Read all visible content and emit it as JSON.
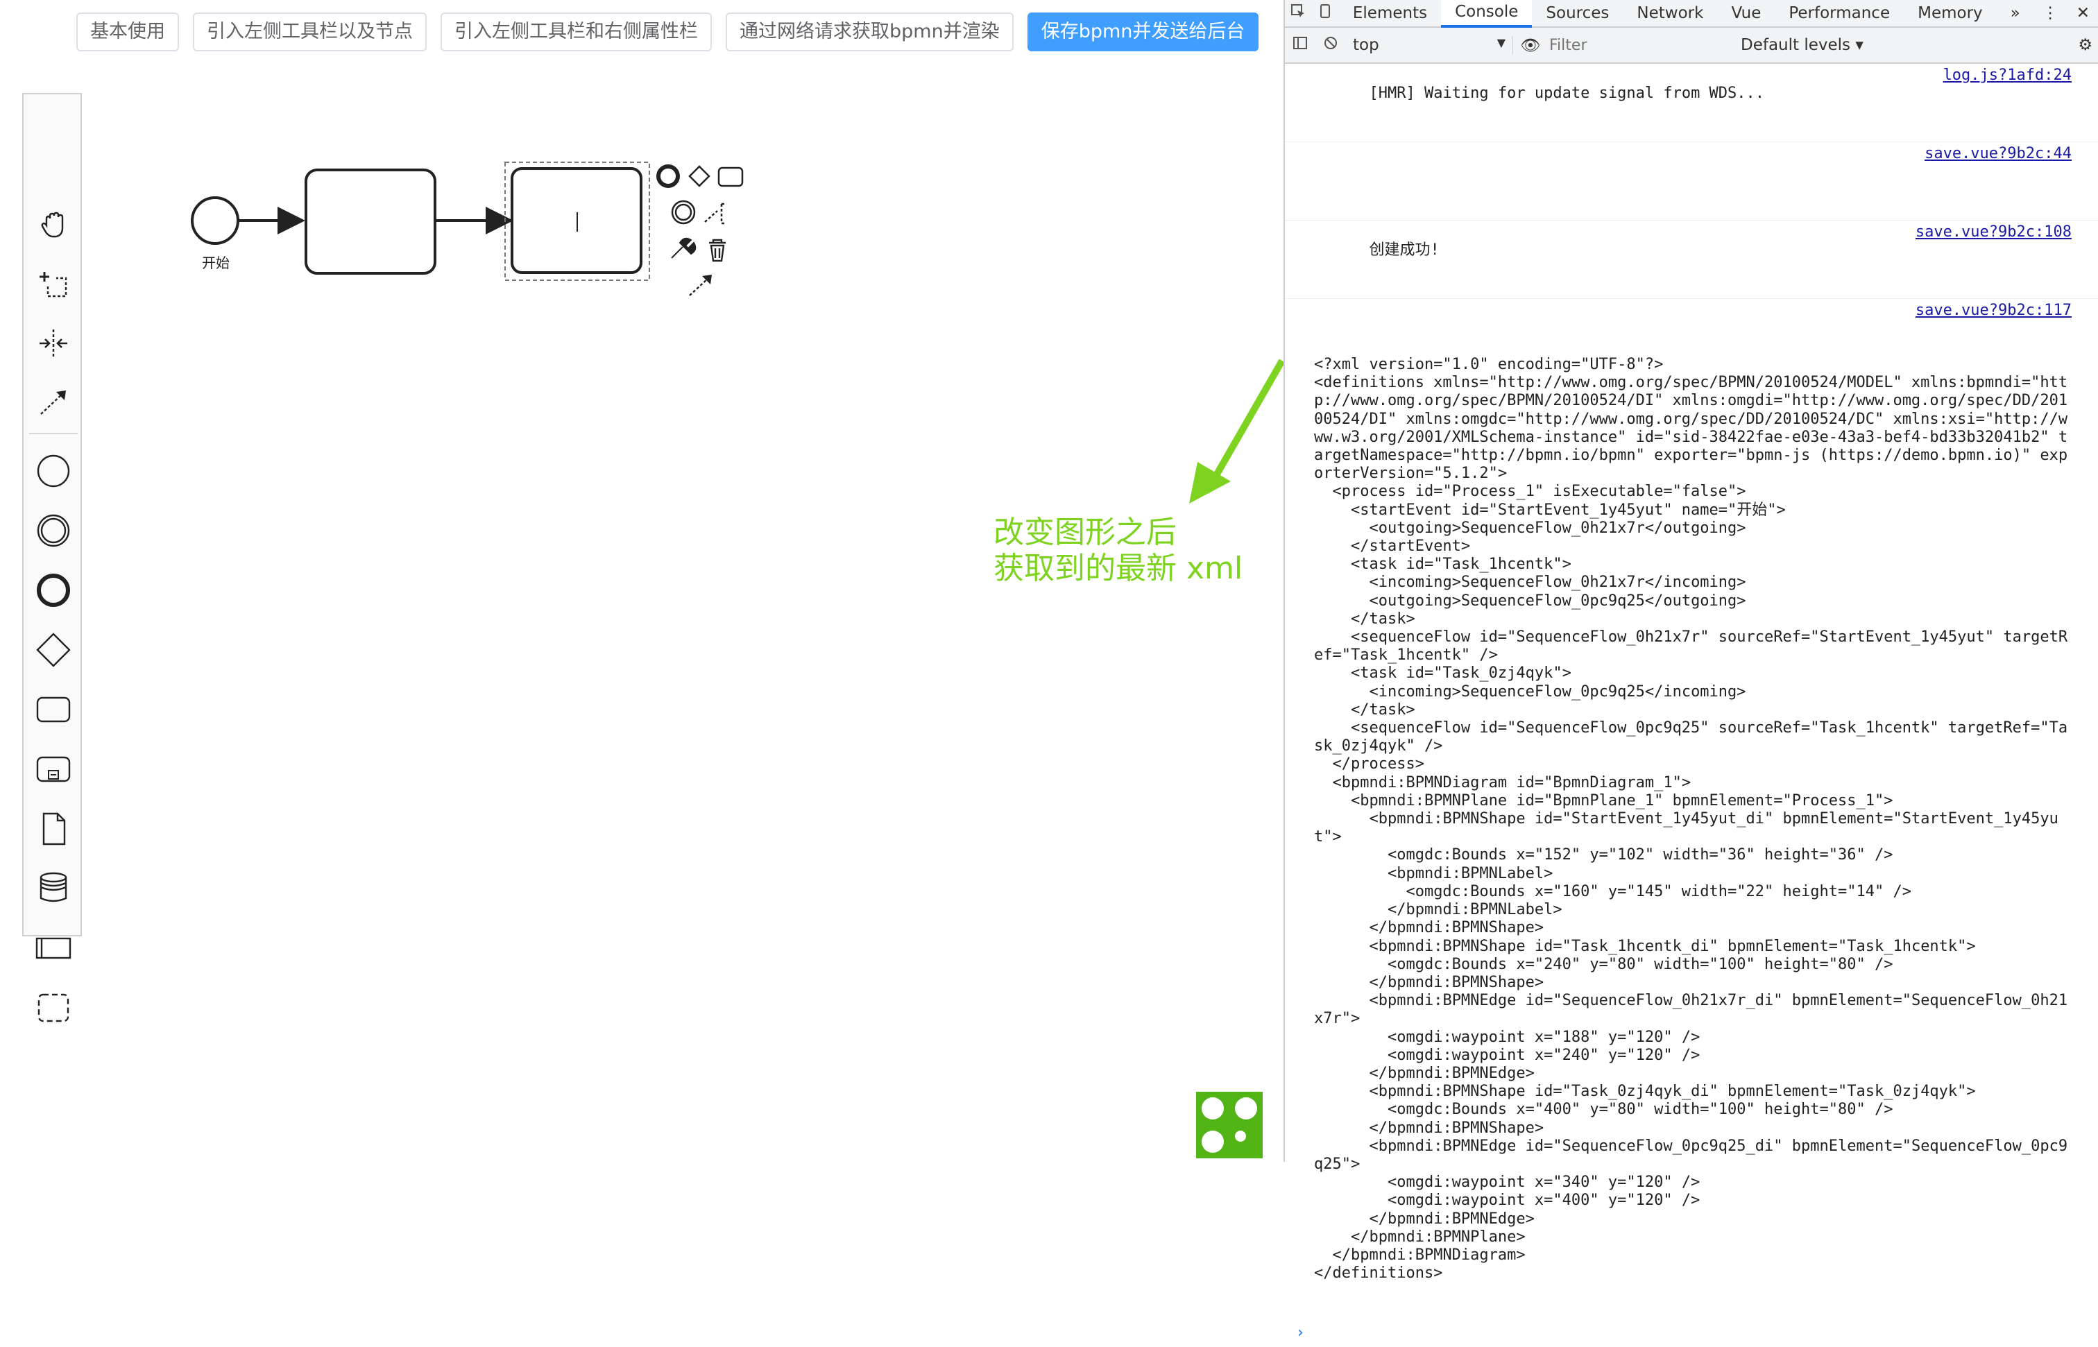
{
  "toolbar": {
    "buttons": [
      "基本使用",
      "引入左侧工具栏以及节点",
      "引入左侧工具栏和右侧属性栏",
      "通过网络请求获取bpmn并渲染",
      "保存bpmn并发送给后台"
    ]
  },
  "diagram": {
    "start_label": "开始",
    "annotation_line1": "改变图形之后",
    "annotation_line2": "获取到的最新 xml"
  },
  "colors": {
    "accent": "#409eff",
    "annotation": "#7ed321",
    "link": "#1a1aa6"
  },
  "devtools": {
    "tabs": [
      "Elements",
      "Console",
      "Sources",
      "Network",
      "Vue",
      "Performance",
      "Memory",
      "»"
    ],
    "context": "top",
    "filter_placeholder": "Filter",
    "levels": "Default levels ▾",
    "console": [
      {
        "text": "[HMR] Waiting for update signal from WDS...",
        "src": "log.js?1afd:24"
      },
      {
        "text": "",
        "src": "save.vue?9b2c:44"
      },
      {
        "text": "创建成功!",
        "src": "save.vue?9b2c:108"
      }
    ],
    "xml_src": "save.vue?9b2c:117",
    "xml": "<?xml version=\"1.0\" encoding=\"UTF-8\"?>\n<definitions xmlns=\"http://www.omg.org/spec/BPMN/20100524/MODEL\" xmlns:bpmndi=\"http://www.omg.org/spec/BPMN/20100524/DI\" xmlns:omgdi=\"http://www.omg.org/spec/DD/20100524/DI\" xmlns:omgdc=\"http://www.omg.org/spec/DD/20100524/DC\" xmlns:xsi=\"http://www.w3.org/2001/XMLSchema-instance\" id=\"sid-38422fae-e03e-43a3-bef4-bd33b32041b2\" targetNamespace=\"http://bpmn.io/bpmn\" exporter=\"bpmn-js (https://demo.bpmn.io)\" exporterVersion=\"5.1.2\">\n  <process id=\"Process_1\" isExecutable=\"false\">\n    <startEvent id=\"StartEvent_1y45yut\" name=\"开始\">\n      <outgoing>SequenceFlow_0h21x7r</outgoing>\n    </startEvent>\n    <task id=\"Task_1hcentk\">\n      <incoming>SequenceFlow_0h21x7r</incoming>\n      <outgoing>SequenceFlow_0pc9q25</outgoing>\n    </task>\n    <sequenceFlow id=\"SequenceFlow_0h21x7r\" sourceRef=\"StartEvent_1y45yut\" targetRef=\"Task_1hcentk\" />\n    <task id=\"Task_0zj4qyk\">\n      <incoming>SequenceFlow_0pc9q25</incoming>\n    </task>\n    <sequenceFlow id=\"SequenceFlow_0pc9q25\" sourceRef=\"Task_1hcentk\" targetRef=\"Task_0zj4qyk\" />\n  </process>\n  <bpmndi:BPMNDiagram id=\"BpmnDiagram_1\">\n    <bpmndi:BPMNPlane id=\"BpmnPlane_1\" bpmnElement=\"Process_1\">\n      <bpmndi:BPMNShape id=\"StartEvent_1y45yut_di\" bpmnElement=\"StartEvent_1y45yut\">\n        <omgdc:Bounds x=\"152\" y=\"102\" width=\"36\" height=\"36\" />\n        <bpmndi:BPMNLabel>\n          <omgdc:Bounds x=\"160\" y=\"145\" width=\"22\" height=\"14\" />\n        </bpmndi:BPMNLabel>\n      </bpmndi:BPMNShape>\n      <bpmndi:BPMNShape id=\"Task_1hcentk_di\" bpmnElement=\"Task_1hcentk\">\n        <omgdc:Bounds x=\"240\" y=\"80\" width=\"100\" height=\"80\" />\n      </bpmndi:BPMNShape>\n      <bpmndi:BPMNEdge id=\"SequenceFlow_0h21x7r_di\" bpmnElement=\"SequenceFlow_0h21x7r\">\n        <omgdi:waypoint x=\"188\" y=\"120\" />\n        <omgdi:waypoint x=\"240\" y=\"120\" />\n      </bpmndi:BPMNEdge>\n      <bpmndi:BPMNShape id=\"Task_0zj4qyk_di\" bpmnElement=\"Task_0zj4qyk\">\n        <omgdc:Bounds x=\"400\" y=\"80\" width=\"100\" height=\"80\" />\n      </bpmndi:BPMNShape>\n      <bpmndi:BPMNEdge id=\"SequenceFlow_0pc9q25_di\" bpmnElement=\"SequenceFlow_0pc9q25\">\n        <omgdi:waypoint x=\"340\" y=\"120\" />\n        <omgdi:waypoint x=\"400\" y=\"120\" />\n      </bpmndi:BPMNEdge>\n    </bpmndi:BPMNPlane>\n  </bpmndi:BPMNDiagram>\n</definitions>"
  }
}
